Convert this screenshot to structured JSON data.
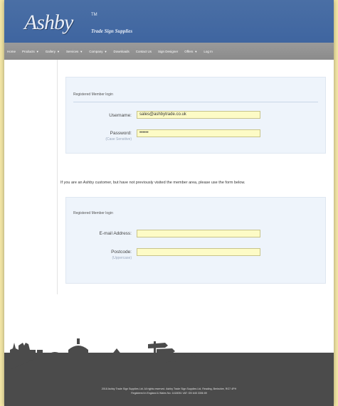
{
  "header": {
    "logo": "Ashby",
    "trademark": "TM",
    "tagline": "Trade Sign Supplies"
  },
  "nav": {
    "items": [
      {
        "label": "Home",
        "dropdown": false
      },
      {
        "label": "Products",
        "dropdown": true
      },
      {
        "label": "Gallery",
        "dropdown": true
      },
      {
        "label": "Services",
        "dropdown": true
      },
      {
        "label": "Company",
        "dropdown": true
      },
      {
        "label": "Downloads",
        "dropdown": false
      },
      {
        "label": "Contact Us",
        "dropdown": false
      },
      {
        "label": "Sign Designer",
        "dropdown": false
      },
      {
        "label": "Offers",
        "dropdown": true
      },
      {
        "label": "Log In",
        "dropdown": false
      }
    ],
    "caret_glyph": "▼"
  },
  "login_panel": {
    "title": "Registered Member login",
    "username_label": "Username:",
    "username_value": "sales@ashbytrade.co.uk",
    "password_label": "Password:",
    "password_hint": "(Case Sensitive)",
    "password_value": "••••••"
  },
  "notice": "If you are an Ashby customer, but have not previously visited the member area, please use the form below.",
  "register_panel": {
    "title": "Registered Member login",
    "email_label": "E-mail Address:",
    "email_value": "",
    "postcode_label": "Postcode:",
    "postcode_hint": "(Uppercase)",
    "postcode_value": ""
  },
  "footer": {
    "line1": "2018 Ashby Trade Sign Supplies Ltd. All rights reserved. Ashby Trade Sign Supplies Ltd, Reading, Berkshire, RG7 4PH",
    "line2": "Registered in England & Wales No: 1418051 VAT: GB 645 3356 89"
  },
  "colors": {
    "header_blue": "#4a6fa5",
    "nav_grey": "#8f8f8f",
    "panel_bg": "#eef4fb",
    "field_yellow": "#fdfbc6",
    "footer_dark": "#4b4b4b",
    "background": "#f4e7a6"
  }
}
